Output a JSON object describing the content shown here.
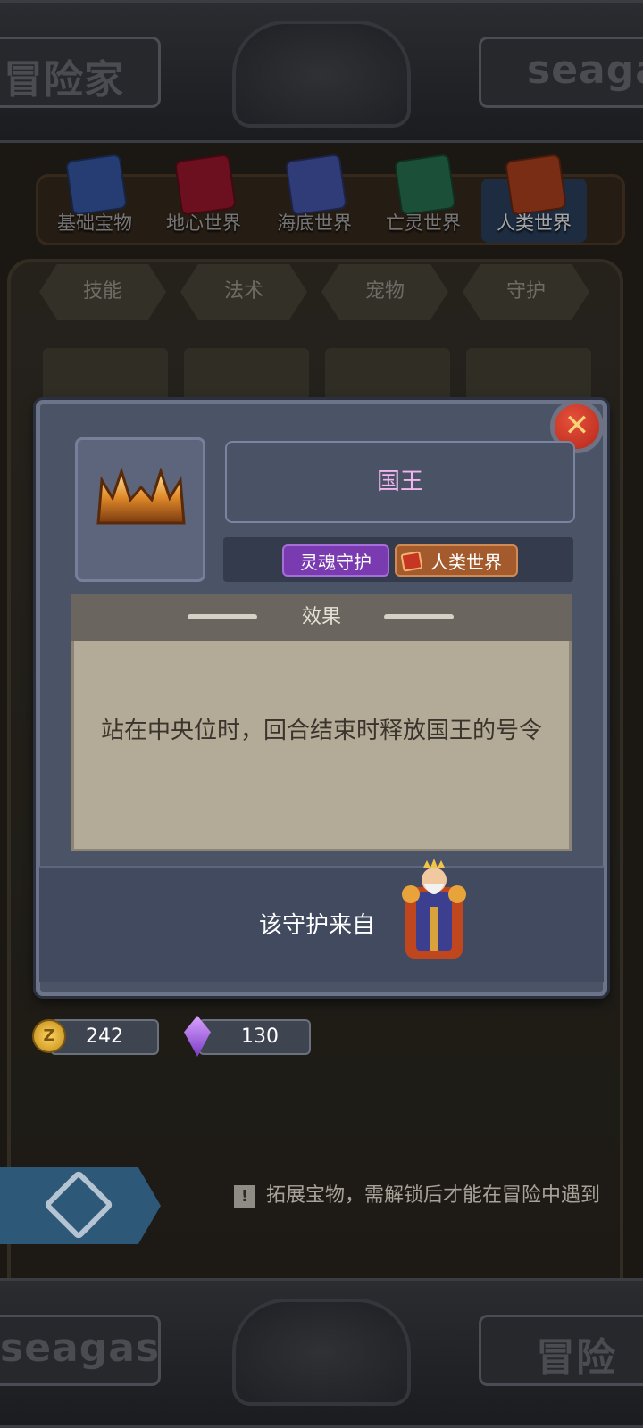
{
  "banners": {
    "top_text_left": "冒险家",
    "top_text_right": "seaga",
    "bottom_text_left": "seagas",
    "bottom_text_right": "冒险"
  },
  "world_tabs": [
    {
      "label": "基础宝物",
      "color": "#3a5fb0"
    },
    {
      "label": "地心世界",
      "color": "#a7182e"
    },
    {
      "label": "海底世界",
      "color": "#4a5cb8"
    },
    {
      "label": "亡灵世界",
      "color": "#2c7a55"
    },
    {
      "label": "人类世界",
      "color": "#b8461f",
      "active": true
    }
  ],
  "category_tabs": [
    "技能",
    "法术",
    "宠物",
    "守护"
  ],
  "modal": {
    "name": "国王",
    "tag_type": "灵魂守护",
    "tag_world": "人类世界",
    "effect_title": "效果",
    "effect_text": "站在中央位时，回合结束时释放国王的号令",
    "from_label": "该守护来自",
    "close_symbol": "✕"
  },
  "currency": {
    "gold": "242",
    "gems": "130",
    "gold_icon_char": "Z"
  },
  "hint": {
    "icon": "!",
    "text": "拓展宝物，需解锁后才能在冒险中遇到"
  },
  "colors": {
    "accent_purple": "#7a3bb0",
    "name_color": "#f3b6f0",
    "close_red": "#d23a28"
  }
}
